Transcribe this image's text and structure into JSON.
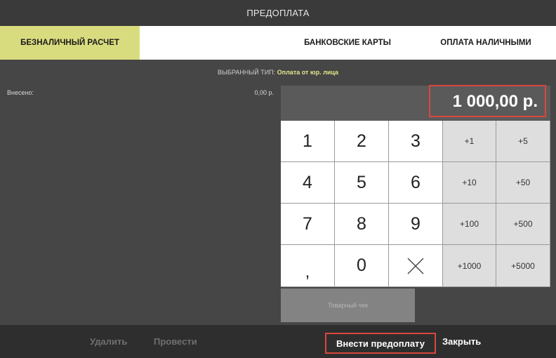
{
  "window": {
    "title": "ПРЕДОПЛАТА"
  },
  "tabs": [
    {
      "label": "БЕЗНАЛИЧНЫЙ РАСЧЕТ",
      "active": true
    },
    {
      "label": "БАНКОВСКИЕ КАРТЫ",
      "active": false
    },
    {
      "label": "ОПЛАТА НАЛИЧНЫМИ",
      "active": false
    }
  ],
  "selected_type": {
    "prefix": "ВЫБРАННЫЙ ТИП:",
    "value": "Оплата от юр. лица"
  },
  "paid": {
    "label": "Внесено:",
    "value": "0,00 р."
  },
  "display": {
    "amount": "1 000,00 р."
  },
  "keypad": {
    "keys": [
      [
        "1",
        "2",
        "3",
        "+1",
        "+5"
      ],
      [
        "4",
        "5",
        "6",
        "+10",
        "+50"
      ],
      [
        "7",
        "8",
        "9",
        "+100",
        "+500"
      ],
      [
        ",",
        "0",
        "backspace",
        "+1000",
        "+5000"
      ]
    ]
  },
  "receipt_button": {
    "label": "Товарный чек"
  },
  "footer": {
    "delete_label": "Удалить",
    "post_label": "Провести",
    "prepay_label": "Внести предоплату",
    "close_label": "Закрыть"
  },
  "colors": {
    "accent_tab": "#d9dc7e",
    "highlight_border": "#d9473d",
    "selected_type_value": "#e4e68a"
  }
}
